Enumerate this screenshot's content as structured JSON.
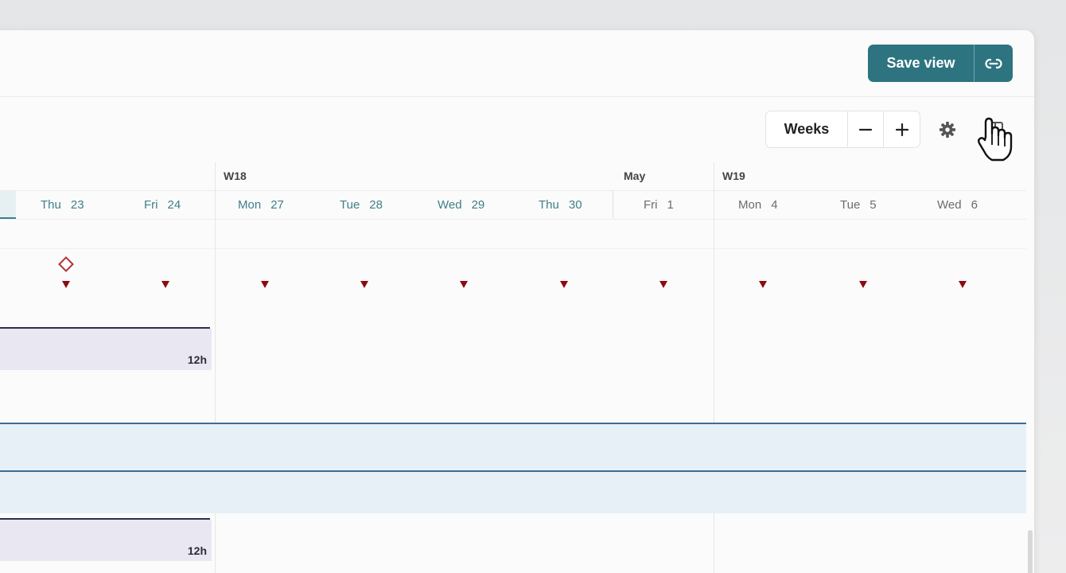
{
  "toolbar": {
    "save_view_label": "Save view",
    "copy_link_icon": "link-icon",
    "zoom_level_label": "Weeks",
    "zoom_out_icon": "minus-icon",
    "zoom_in_icon": "plus-icon",
    "settings_icon": "gear-icon",
    "sidebar_toggle_icon": "sidebar-panel-icon"
  },
  "timeline": {
    "weeks": [
      {
        "label": "W18"
      },
      {
        "label": "W19"
      }
    ],
    "month_label": "May",
    "days": [
      {
        "name": "Thu",
        "num": "23",
        "in_range": true
      },
      {
        "name": "Fri",
        "num": "24",
        "in_range": true
      },
      {
        "name": "Mon",
        "num": "27",
        "in_range": true
      },
      {
        "name": "Tue",
        "num": "28",
        "in_range": true
      },
      {
        "name": "Wed",
        "num": "29",
        "in_range": true
      },
      {
        "name": "Thu",
        "num": "30",
        "in_range": true
      },
      {
        "name": "Fri",
        "num": "1",
        "in_range": false
      },
      {
        "name": "Mon",
        "num": "4",
        "in_range": false
      },
      {
        "name": "Tue",
        "num": "5",
        "in_range": false
      },
      {
        "name": "Wed",
        "num": "6",
        "in_range": false
      }
    ],
    "rows": [
      {
        "kind": "milestone",
        "icon": "diamond-milestone-icon"
      },
      {
        "kind": "deadline-markers",
        "icon": "triangle-down-icon",
        "count": 10
      },
      {
        "kind": "work-package-bar",
        "hours": "12h"
      },
      {
        "kind": "group-band"
      },
      {
        "kind": "group-band"
      },
      {
        "kind": "work-package-bar",
        "hours": "12h"
      }
    ]
  },
  "colors": {
    "accent": "#2d7480",
    "marker": "#8e0a10",
    "bar": "#e8e7f2",
    "band": "#e7f0f6"
  }
}
